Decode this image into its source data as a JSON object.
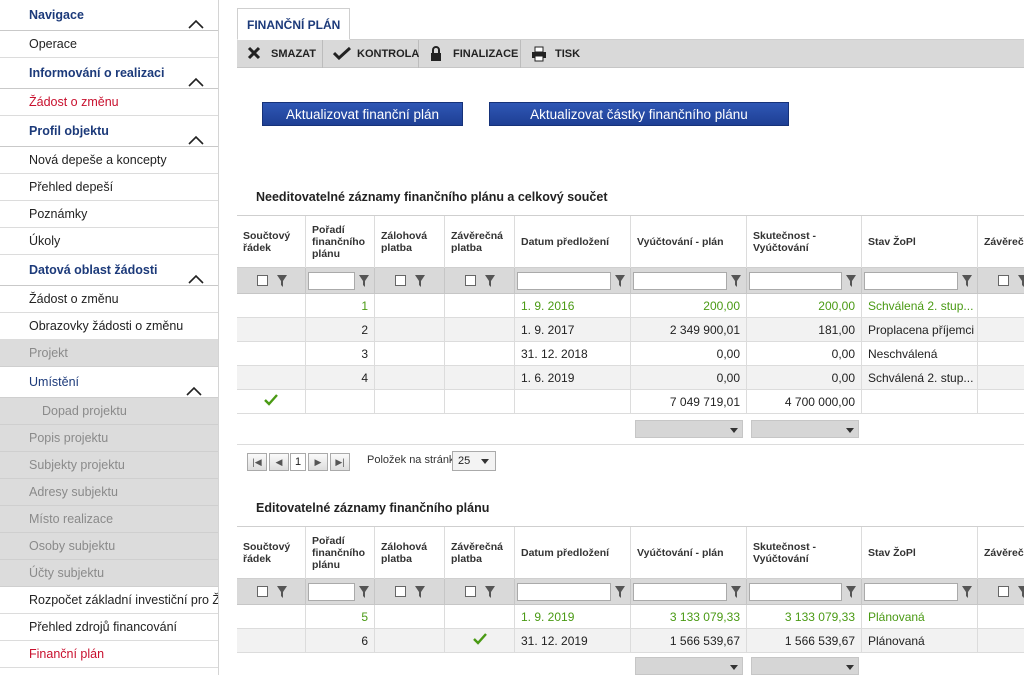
{
  "sidebar": {
    "items": [
      {
        "label": "Navigace",
        "kind": "head"
      },
      {
        "label": "Operace",
        "kind": "item"
      },
      {
        "label": "Informování o realizaci",
        "kind": "head"
      },
      {
        "label": "Žádost o změnu",
        "kind": "red"
      },
      {
        "label": "Profil objektu",
        "kind": "head"
      },
      {
        "label": "Nová depeše a koncepty",
        "kind": "item"
      },
      {
        "label": "Přehled depeší",
        "kind": "item"
      },
      {
        "label": "Poznámky",
        "kind": "item"
      },
      {
        "label": "Úkoly",
        "kind": "item"
      },
      {
        "label": "Datová oblast žádosti",
        "kind": "head"
      },
      {
        "label": "Žádost o změnu",
        "kind": "item"
      },
      {
        "label": "Obrazovky žádosti o změnu",
        "kind": "item"
      },
      {
        "label": "Projekt",
        "kind": "gray"
      },
      {
        "label": "Umístění",
        "kind": "grayblue"
      },
      {
        "label": "Dopad projektu",
        "kind": "graysub"
      },
      {
        "label": "Popis projektu",
        "kind": "gray"
      },
      {
        "label": "Subjekty projektu",
        "kind": "gray"
      },
      {
        "label": "Adresy subjektu",
        "kind": "gray"
      },
      {
        "label": "Místo realizace",
        "kind": "gray"
      },
      {
        "label": "Osoby subjektu",
        "kind": "gray"
      },
      {
        "label": "Účty subjektu",
        "kind": "gray"
      },
      {
        "label": "Rozpočet základní investiční pro ŽoZ",
        "kind": "item"
      },
      {
        "label": "Přehled zdrojů financování",
        "kind": "item"
      },
      {
        "label": "Finanční plán",
        "kind": "red"
      }
    ]
  },
  "tab": {
    "label": "FINANČNÍ PLÁN"
  },
  "toolbar": {
    "delete": "SMAZAT",
    "check": "KONTROLA",
    "finalize": "FINALIZACE",
    "print": "TISK"
  },
  "buttons": {
    "update_plan": "Aktualizovat finanční plán",
    "update_amounts": "Aktualizovat částky finančního plánu"
  },
  "section1": {
    "title": "Needitovatelné záznamy finančního plánu a celkový součet"
  },
  "section2": {
    "title": "Editovatelné záznamy finančního plánu"
  },
  "columns": [
    "Součtový řádek",
    "Pořadí finančního plánu",
    "Zálohová platba",
    "Závěrečná platba",
    "Datum předložení",
    "Vyúčtování - plán",
    "Skutečnost - Vyúčtování",
    "Stav ŽoPl",
    "Závěrečn"
  ],
  "table1": {
    "rows": [
      {
        "sum": "",
        "order": "1",
        "advance": "",
        "final": "",
        "date": "1. 9. 2016",
        "plan": "200,00",
        "actual": "200,00",
        "state": "Schválená 2. stup...",
        "green": true
      },
      {
        "sum": "",
        "order": "2",
        "advance": "",
        "final": "",
        "date": "1. 9. 2017",
        "plan": "2 349 900,01",
        "actual": "181,00",
        "state": "Proplacena příjemci",
        "green": false
      },
      {
        "sum": "",
        "order": "3",
        "advance": "",
        "final": "",
        "date": "31. 12. 2018",
        "plan": "0,00",
        "actual": "0,00",
        "state": "Neschválená",
        "green": false
      },
      {
        "sum": "",
        "order": "4",
        "advance": "",
        "final": "",
        "date": "1. 6. 2019",
        "plan": "0,00",
        "actual": "0,00",
        "state": "Schválená 2. stup...",
        "green": false
      }
    ],
    "total": {
      "plan": "7 049 719,01",
      "actual": "4 700 000,00"
    }
  },
  "pager": {
    "page": "1",
    "label": "Položek na stránku",
    "per_page": "25"
  },
  "table2": {
    "rows": [
      {
        "order": "5",
        "date": "1. 9. 2019",
        "plan": "3 133 079,33",
        "actual": "3 133 079,33",
        "state": "Plánovaná",
        "green": true,
        "final_check": false
      },
      {
        "order": "6",
        "date": "31. 12. 2019",
        "plan": "1 566 539,67",
        "actual": "1 566 539,67",
        "state": "Plánovaná",
        "green": false,
        "final_check": true
      }
    ]
  },
  "colors": {
    "nav_blue": "#1c3a7a",
    "link_red": "#c8102e",
    "ok_green": "#4a9a14",
    "button_blue": "#1e3f94"
  }
}
